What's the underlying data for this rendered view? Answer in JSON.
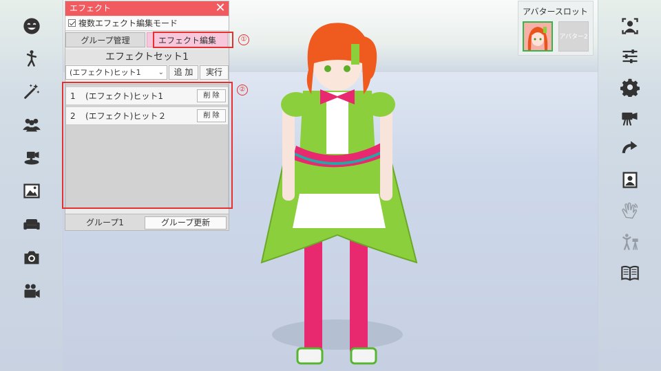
{
  "effect_panel": {
    "title": "エフェクト",
    "multi_edit_label": "複数エフェクト編集モード",
    "tabs": {
      "group_manage": "グループ管理",
      "effect_edit": "エフェクト編集"
    },
    "set_title": "エフェクトセット1",
    "select_value": "(エフェクト)ヒット1",
    "add_button": "追 加",
    "run_button": "実行",
    "list": [
      {
        "num": "1",
        "name": "(エフェクト)ヒット1",
        "delete": "削 除"
      },
      {
        "num": "2",
        "name": "(エフェクト)ヒット２",
        "delete": "削 除"
      }
    ],
    "group_label": "グループ1",
    "group_update_button": "グループ更新"
  },
  "annotations": {
    "first": "①",
    "second": "②"
  },
  "avatar_slot": {
    "title": "アバタースロット",
    "slot2_label": "アバター2"
  },
  "left_toolbar": [
    "face-icon",
    "pose-icon",
    "magic-wand-icon",
    "people-icon",
    "video-camera-stand-icon",
    "image-icon",
    "sofa-icon",
    "camera-icon",
    "movie-camera-icon"
  ],
  "right_toolbar": [
    "person-focus-icon",
    "sliders-icon",
    "gear-icon",
    "video-settings-icon",
    "redo-icon",
    "portrait-icon",
    "wave-hand-icon",
    "pose-tripod-icon",
    "book-icon"
  ],
  "colors": {
    "title_bar": "#f15a5e",
    "active_tab": "#f9c7dc",
    "annotation": "#e53030",
    "avatar_selected": "#34b54a"
  }
}
